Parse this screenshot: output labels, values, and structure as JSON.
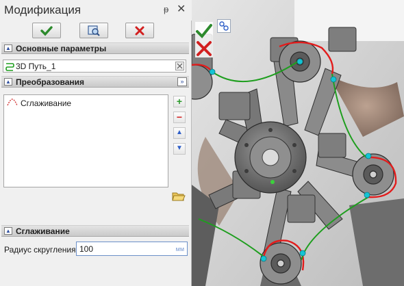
{
  "panel": {
    "title": "Модификация",
    "pin_glyph": "ᵽ",
    "close_glyph": "✕",
    "toolbar": {
      "ok_icon": "check-icon",
      "preview_icon": "preview-icon",
      "cancel_icon": "cancel-icon"
    },
    "main_params": {
      "header": "Основные параметры",
      "path_value": "3D Путь_1"
    },
    "transforms": {
      "header": "Преобразования",
      "items": [
        {
          "label": "Сглаживание",
          "icon": "smoothing-icon"
        }
      ],
      "side_buttons": [
        "+",
        "−",
        "▲",
        "▼"
      ]
    },
    "smoothing": {
      "header": "Сглаживание",
      "radius_label": "Радиус скругления:",
      "radius_value": "100",
      "radius_unit": "мм"
    }
  },
  "viewport": {
    "confirm_icon": "check-icon",
    "cancel_icon": "cancel-icon",
    "grab_icon": "grab-icon"
  },
  "colors": {
    "accent": "#2c8a2c",
    "cancel": "#d21f1f",
    "path_green": "#1e9e1e",
    "path_red": "#e21c1c",
    "point_cyan": "#14c4d4"
  }
}
